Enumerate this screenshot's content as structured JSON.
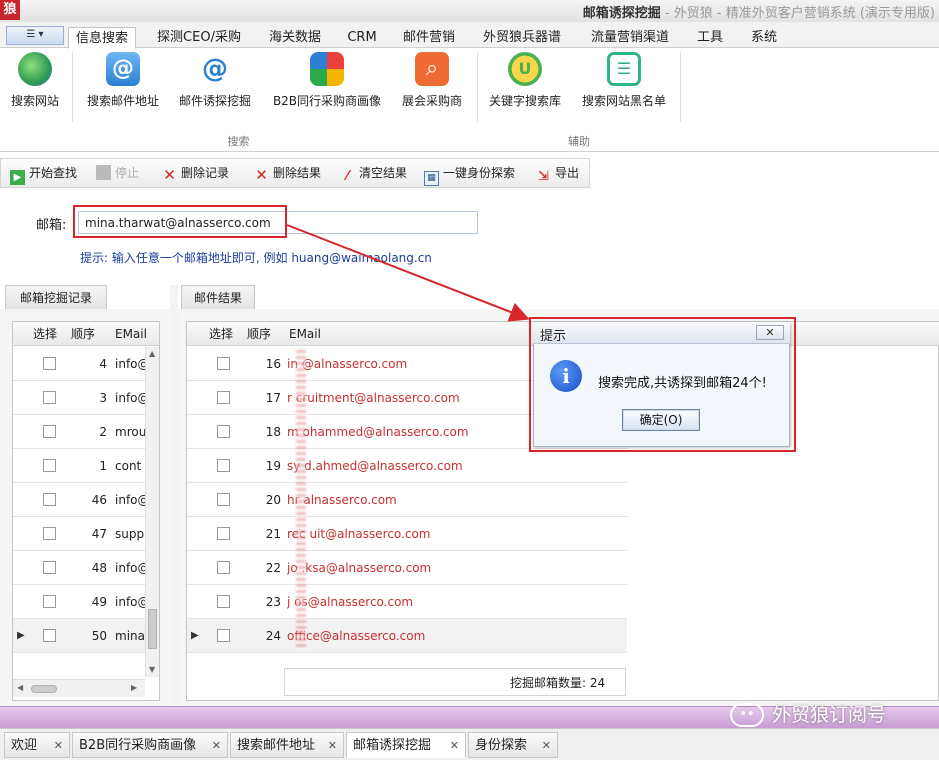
{
  "window": {
    "logo": "狼",
    "title_main": "邮箱诱探挖掘",
    "title_rest": " - 外贸狼 - 精准外贸客户营销系统 (演示专用版)"
  },
  "ribbon_tabs": [
    "信息搜索",
    "探测CEO/采购",
    "海关数据",
    "CRM",
    "邮件营销",
    "外贸狼兵器谱",
    "流量营销渠道",
    "工具",
    "系统"
  ],
  "ribbon": {
    "buttons": [
      {
        "label": "搜索网站",
        "icon": "globe-search-icon"
      },
      {
        "label": "搜索邮件地址",
        "icon": "at-mail-icon"
      },
      {
        "label": "邮件诱探挖掘",
        "icon": "at-probe-icon"
      },
      {
        "label": "B2B同行采购商画像",
        "icon": "b2b-tiles-icon"
      },
      {
        "label": "展会采购商",
        "icon": "search-magnifier-icon"
      },
      {
        "label": "关键字搜索库",
        "icon": "shopping-bag-icon"
      },
      {
        "label": "搜索网站黑名单",
        "icon": "checklist-icon"
      }
    ],
    "group_search": "搜索",
    "group_assist": "辅助"
  },
  "toolbar": {
    "start": "开始查找",
    "stop": "停止",
    "delete_record": "删除记录",
    "delete_result": "删除结果",
    "clear_result": "清空结果",
    "identity_probe": "一键身份探索",
    "export": "导出"
  },
  "form": {
    "email_label": "邮箱:",
    "email_value": "mina.tharwat@alnasserco.com",
    "hint_prefix": "提示: 输入任意一个邮箱地址即可, 例如 ",
    "hint_example": "huang@waimaolang.cn"
  },
  "left_panel": {
    "tab": "邮箱挖掘记录",
    "columns": [
      "选择",
      "顺序",
      "EMail"
    ],
    "rows": [
      {
        "order": "4",
        "email": "info@"
      },
      {
        "order": "3",
        "email": "info@"
      },
      {
        "order": "2",
        "email": "mrou"
      },
      {
        "order": "1",
        "email": "cont"
      },
      {
        "order": "46",
        "email": "info@"
      },
      {
        "order": "47",
        "email": "supp"
      },
      {
        "order": "48",
        "email": "info@"
      },
      {
        "order": "49",
        "email": "info@"
      },
      {
        "order": "50",
        "email": "mina"
      }
    ]
  },
  "right_panel": {
    "tab": "邮件结果",
    "columns": [
      "选择",
      "顺序",
      "EMail"
    ],
    "rows": [
      {
        "order": "16",
        "email": "in  @alnasserco.com"
      },
      {
        "order": "17",
        "email": "r   cruitment@alnasserco.com"
      },
      {
        "order": "18",
        "email": "m  ohammed@alnasserco.com"
      },
      {
        "order": "19",
        "email": "sy  d.ahmed@alnasserco.com"
      },
      {
        "order": "20",
        "email": "hr  alnasserco.com"
      },
      {
        "order": "21",
        "email": "rec  uit@alnasserco.com"
      },
      {
        "order": "22",
        "email": "jo  .ksa@alnasserco.com"
      },
      {
        "order": "23",
        "email": "j  os@alnasserco.com"
      },
      {
        "order": "24",
        "email": "   office@alnasserco.com"
      }
    ],
    "count_label": "挖掘邮箱数量: 24"
  },
  "dialog": {
    "title": "提示",
    "message": "搜索完成,共诱探到邮箱24个!",
    "ok": "确定(O)"
  },
  "bottom_tabs": [
    "欢迎",
    "B2B同行采购商画像",
    "搜索邮件地址",
    "邮箱诱探挖掘",
    "身份探索"
  ],
  "watermark": "外贸狼订阅号",
  "colors": {
    "highlight": "#d8262c",
    "email_red": "#c73030",
    "hint_blue": "#1a3d9c"
  }
}
